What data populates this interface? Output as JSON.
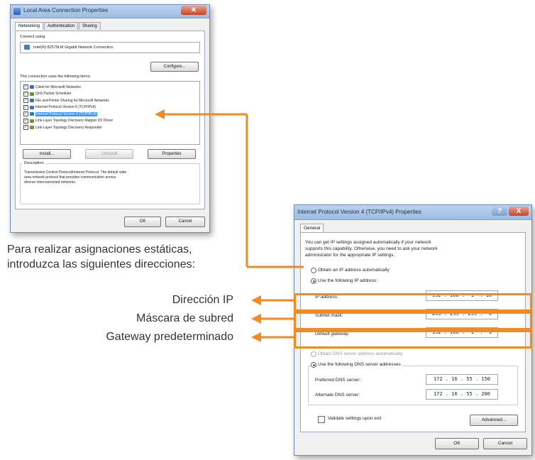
{
  "left_dialog": {
    "title": "Local Area Connection Properties",
    "tabs": [
      "Networking",
      "Authentication",
      "Sharing"
    ],
    "connect_using_label": "Connect using:",
    "adapter": "Intel(R) 82579LM Gigabit Network Connection",
    "configure_label": "Configure...",
    "items_label": "This connection uses the following items:",
    "items": [
      {
        "label": "Client for Microsoft Networks",
        "checked": true,
        "selected": false
      },
      {
        "label": "QoS Packet Scheduler",
        "checked": true,
        "selected": false
      },
      {
        "label": "File and Printer Sharing for Microsoft Networks",
        "checked": true,
        "selected": false
      },
      {
        "label": "Internet Protocol Version 6 (TCP/IPv6)",
        "checked": true,
        "selected": false
      },
      {
        "label": "Internet Protocol Version 4 (TCP/IPv4)",
        "checked": true,
        "selected": true
      },
      {
        "label": "Link-Layer Topology Discovery Mapper I/O Driver",
        "checked": true,
        "selected": false
      },
      {
        "label": "Link-Layer Topology Discovery Responder",
        "checked": true,
        "selected": false
      }
    ],
    "install_label": "Install...",
    "uninstall_label": "Uninstall",
    "properties_label": "Properties",
    "description_label": "Description",
    "description_text_1": "Transmission Control Protocol/Internet Protocol. The default wide",
    "description_text_2": "area network protocol that provides communication across",
    "description_text_3": "diverse interconnected networks.",
    "ok_label": "OK",
    "cancel_label": "Cancel"
  },
  "caption": {
    "line1": "Para realizar asignaciones estáticas,",
    "line2": "introduzca las siguientes direcciones:"
  },
  "annotations": {
    "ip": "Dirección IP",
    "mask": "Máscara de subred",
    "gateway": "Gateway predeterminado"
  },
  "right_dialog": {
    "title": "Internet Protocol Version 4 (TCP/IPv4) Properties",
    "help_label": "?",
    "close_label": "X",
    "tab": "General",
    "intro_1": "You can get IP settings assigned automatically if your network",
    "intro_2": "supports this capability. Otherwise, you need to ask your network",
    "intro_3": "administrator for the appropriate IP settings.",
    "obtain_auto_label": "Obtain an IP address automatically",
    "use_following_label": "Use the following IP address:",
    "ip_label": "IP address:",
    "ip_value": "192 . 168 .  1  . 10",
    "mask_label": "Subnet mask:",
    "mask_value": "255 . 255 . 255 .  0",
    "gateway_label": "Default gateway:",
    "gateway_value": "192 . 168 .  1  .  1",
    "dns_auto_label": "Obtain DNS server address automatically",
    "dns_use_label": "Use the following DNS server addresses",
    "pref_dns_label": "Preferred DNS server:",
    "pref_dns_value": "172 . 16 . 55 . 150",
    "alt_dns_label": "Alternate DNS server:",
    "alt_dns_value": "172 . 16 . 55 . 200",
    "validate_label": "Validate settings upon exit",
    "advanced_label": "Advanced...",
    "ok_label": "OK",
    "cancel_label": "Cancel"
  },
  "colors": {
    "accent": "#f08a24",
    "selection": "#3399ff",
    "title_bg": "#9dbbe2"
  }
}
